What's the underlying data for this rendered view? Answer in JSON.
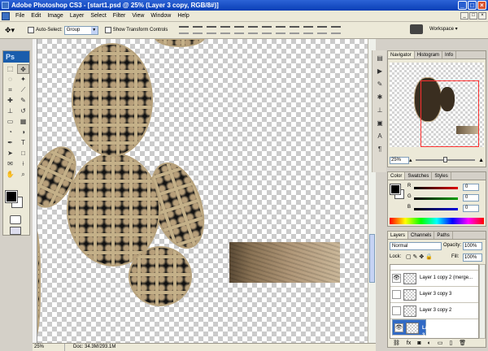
{
  "window": {
    "title": "Adobe Photoshop CS3 - [start1.psd @ 25% (Layer 3 copy, RGB/8#)]",
    "min": "_",
    "max": "□",
    "close": "×"
  },
  "menu": [
    "File",
    "Edit",
    "Image",
    "Layer",
    "Select",
    "Filter",
    "View",
    "Window",
    "Help"
  ],
  "options": {
    "auto_select_label": "Auto-Select:",
    "auto_select_value": "Group",
    "transform_label": "Show Transform Controls",
    "workspace_label": "Workspace ▾"
  },
  "toolbox": {
    "logo": "Ps"
  },
  "status": {
    "zoom": "25%",
    "doc": "Doc: 34.3M/293.1M"
  },
  "navigator": {
    "tabs": [
      "Navigator",
      "Histogram",
      "Info"
    ],
    "zoom": "25%"
  },
  "color_panel": {
    "tabs": [
      "Color",
      "Swatches",
      "Styles"
    ],
    "channels": [
      {
        "label": "R",
        "value": "0",
        "color": "#e00000"
      },
      {
        "label": "G",
        "value": "0",
        "color": "#00a000"
      },
      {
        "label": "B",
        "value": "0",
        "color": "#0000e0"
      }
    ]
  },
  "layers_panel": {
    "tabs": [
      "Layers",
      "Channels",
      "Paths"
    ],
    "blend_mode": "Normal",
    "opacity_label": "Opacity:",
    "opacity": "100%",
    "lock_label": "Lock:",
    "fill_label": "Fill:",
    "fill": "100%",
    "layers": [
      {
        "name": "Layer 1 copy 2 (merge...",
        "visible": true,
        "selected": false
      },
      {
        "name": "Layer 3 copy 3",
        "visible": false,
        "selected": false
      },
      {
        "name": "Layer 3 copy 2",
        "visible": false,
        "selected": false
      },
      {
        "name": "Layer 3 copy",
        "visible": true,
        "selected": true
      }
    ]
  }
}
